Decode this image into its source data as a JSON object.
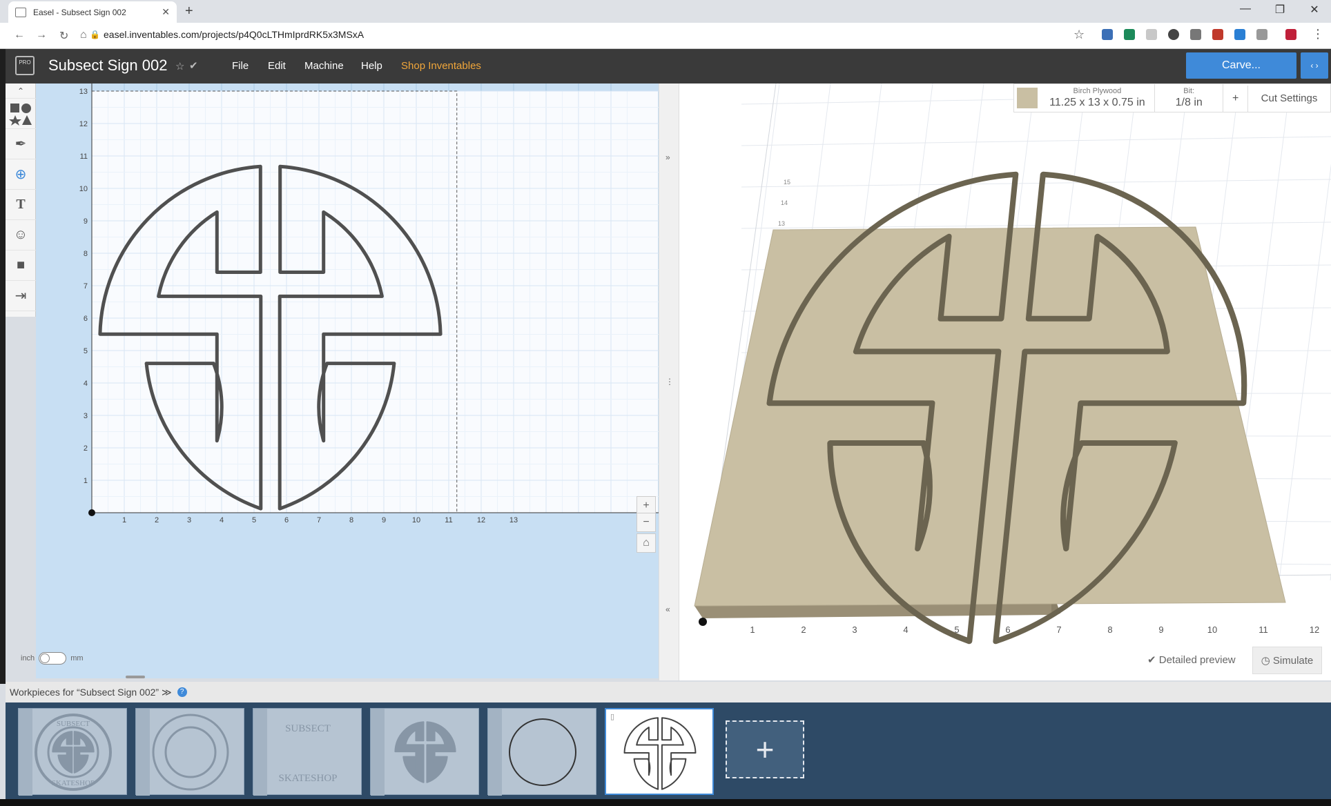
{
  "browser": {
    "tab_title": "Easel - Subsect Sign 002",
    "new_tab": "+",
    "url": "easel.inventables.com/projects/p4Q0cLTHmIprdRK5x3MSxA"
  },
  "app": {
    "logo_text": "PRO",
    "project_title": "Subsect Sign 002",
    "menu": [
      "File",
      "Edit",
      "Machine",
      "Help",
      "Shop Inventables"
    ],
    "carve_label": "Carve...",
    "expand_label": "‹ ›"
  },
  "design": {
    "x_ticks": [
      "1",
      "2",
      "3",
      "4",
      "5",
      "6",
      "7",
      "8",
      "9",
      "10",
      "11",
      "12",
      "13"
    ],
    "y_ticks": [
      "1",
      "2",
      "3",
      "4",
      "5",
      "6",
      "7",
      "8",
      "9",
      "10",
      "11",
      "12",
      "13"
    ],
    "zoom_in": "+",
    "zoom_out": "−",
    "home": "⌂",
    "unit_left": "inch",
    "unit_right": "mm"
  },
  "material": {
    "name": "Birch Plywood",
    "dimensions": "11.25 x 13 x 0.75 in",
    "bit_label": "Bit:",
    "bit_value": "1/8 in",
    "add_label": "+",
    "cut_settings": "Cut Settings",
    "swatch_color": "#c9bfa3"
  },
  "preview": {
    "x_ticks": [
      "1",
      "2",
      "3",
      "4",
      "5",
      "6",
      "7",
      "8",
      "9",
      "10",
      "11",
      "12"
    ],
    "y_ticks": [
      "13",
      "14",
      "15"
    ],
    "detailed_preview": "Detailed preview",
    "simulate": "Simulate"
  },
  "workpieces": {
    "label": "Workpieces for “Subsect Sign 002” ≫",
    "help": "?",
    "items": [
      {
        "kind": "badge",
        "text_top": "SUBSECT",
        "text_bottom": "SKATESHOP"
      },
      {
        "kind": "rings"
      },
      {
        "kind": "ring-text",
        "text_top": "SUBSECT",
        "text_bottom": "SKATESHOP"
      },
      {
        "kind": "symbol-solid"
      },
      {
        "kind": "circle"
      },
      {
        "kind": "symbol-outline",
        "active": true
      }
    ],
    "add": "+"
  },
  "colors": {
    "accent": "#3f8ad9",
    "shop_link": "#f0a63a",
    "header_bg": "#3a3a3a",
    "design_bg": "#c8dff3",
    "wood": "#c9bfa3"
  }
}
